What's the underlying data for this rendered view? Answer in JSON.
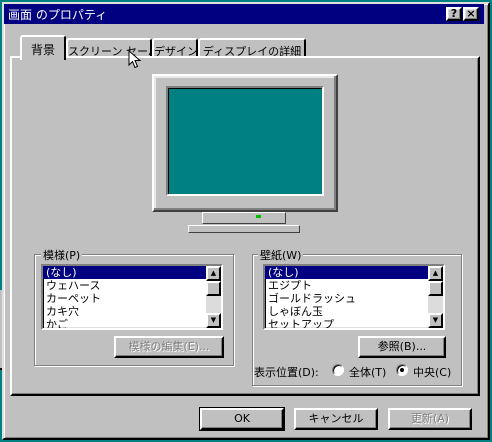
{
  "window": {
    "title": "画面 のプロパティ"
  },
  "titlebar_buttons": {
    "help": "?",
    "close": "×"
  },
  "tabs": [
    {
      "label": "背景",
      "active": true
    },
    {
      "label": "スクリーン セーバー",
      "active": false
    },
    {
      "label": "デザイン",
      "active": false
    },
    {
      "label": "ディスプレイの詳細",
      "active": false
    }
  ],
  "pattern": {
    "group_label": "模様(P)",
    "items": [
      "(なし)",
      "ウェハース",
      "カーペット",
      "カキ穴",
      "かご"
    ],
    "selected_index": 0,
    "edit_button": "模様の編集(E)..."
  },
  "wallpaper": {
    "group_label": "壁紙(W)",
    "items": [
      "(なし)",
      "エジプト",
      "ゴールドラッシュ",
      "しゃぼん玉",
      "セットアップ"
    ],
    "selected_index": 0,
    "browse_button": "参照(B)...",
    "display_label": "表示位置(D):",
    "options": [
      {
        "label": "全体(T)",
        "checked": false
      },
      {
        "label": "中央(C)",
        "checked": true
      }
    ]
  },
  "footer": {
    "ok": "OK",
    "cancel": "キャンセル",
    "apply": "更新(A)"
  },
  "colors": {
    "desktop": "#008080",
    "face": "#c0c0c0",
    "titlebar": "#000080",
    "selection": "#000080"
  }
}
